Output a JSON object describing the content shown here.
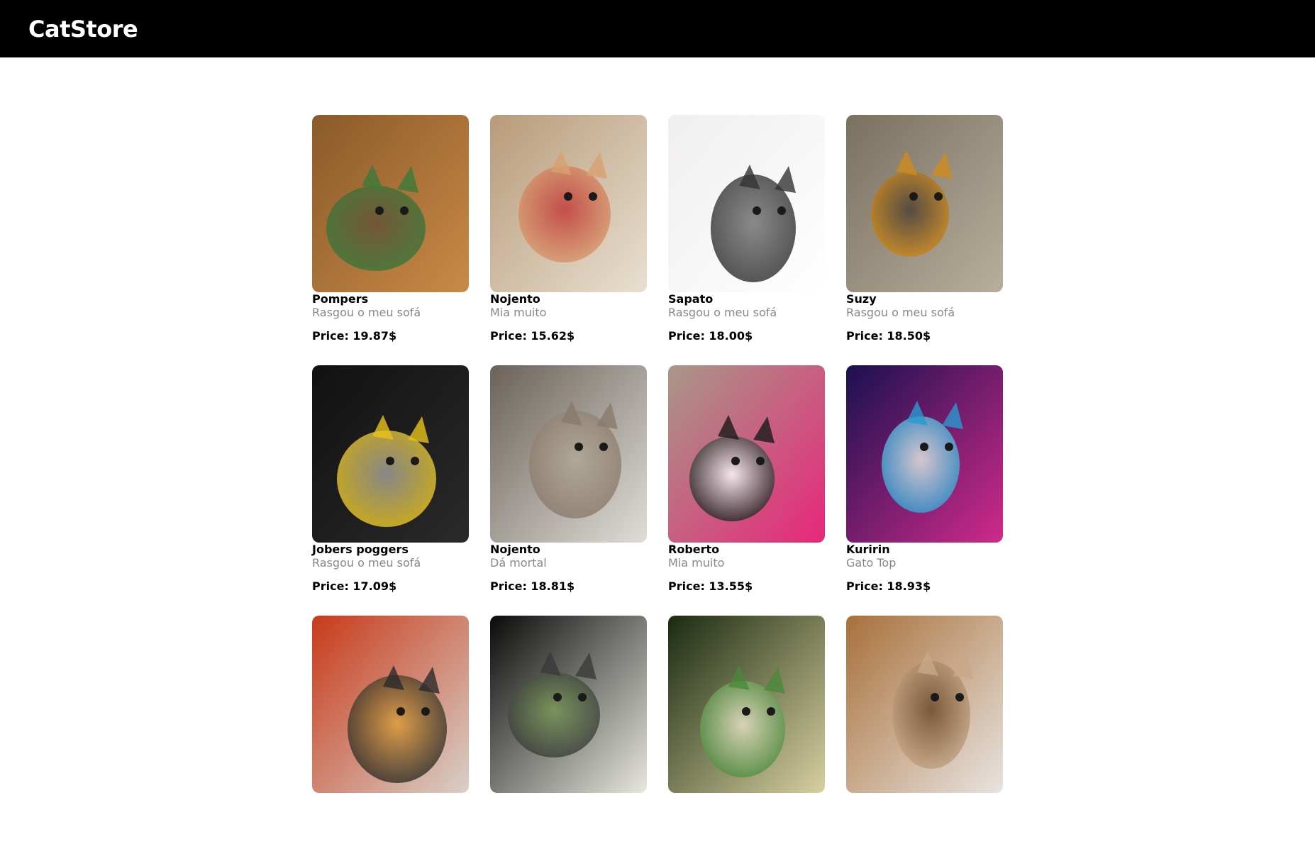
{
  "header": {
    "brand": "CatStore"
  },
  "products": [
    {
      "name": "Pompers",
      "description": "Rasgou o meu sofá",
      "price": "Price: 19.87$",
      "image": "cat-photo",
      "palette": [
        "#8a5a2a",
        "#c98a45",
        "#3a7a3a",
        "#6b5138"
      ]
    },
    {
      "name": "Nojento",
      "description": "Mia muito",
      "price": "Price: 15.62$",
      "image": "cat-photo",
      "palette": [
        "#b89a7a",
        "#e8e0d0",
        "#d8a070",
        "#c23a3a"
      ]
    },
    {
      "name": "Sapato",
      "description": "Rasgou o meu sofá",
      "price": "Price: 18.00$",
      "image": "cat-photo",
      "palette": [
        "#f0eeee",
        "#ffffff",
        "#333333",
        "#777777"
      ]
    },
    {
      "name": "Suzy",
      "description": "Rasgou o meu sofá",
      "price": "Price: 18.50$",
      "image": "cat-photo",
      "palette": [
        "#7a7060",
        "#b8ae9c",
        "#d08a1a",
        "#4a4038"
      ]
    },
    {
      "name": "Jobers poggers",
      "description": "Rasgou o meu sofá",
      "price": "Price: 17.09$",
      "image": "cat-photo",
      "palette": [
        "#111111",
        "#2a2a2a",
        "#e8c21a",
        "#999999"
      ]
    },
    {
      "name": "Nojento",
      "description": "Dá mortal",
      "price": "Price: 18.81$",
      "image": "cat-photo",
      "palette": [
        "#6a625a",
        "#e0ddd8",
        "#8a7a6a",
        "#b0a898"
      ]
    },
    {
      "name": "Roberto",
      "description": "Mia muito",
      "price": "Price: 13.55$",
      "image": "cat-photo",
      "palette": [
        "#a89888",
        "#e8267a",
        "#1a1a1a",
        "#ffffff"
      ]
    },
    {
      "name": "Kuririn",
      "description": "Gato Top",
      "price": "Price: 18.93$",
      "image": "cat-photo",
      "palette": [
        "#1a1050",
        "#d02a8a",
        "#2a9ad0",
        "#e8e4e0"
      ]
    },
    {
      "name": "",
      "description": "",
      "price": "",
      "image": "cat-photo",
      "palette": [
        "#c83a1a",
        "#d8d0c8",
        "#2a2a2a",
        "#e0a040"
      ]
    },
    {
      "name": "",
      "description": "",
      "price": "",
      "image": "cat-photo",
      "palette": [
        "#0a0a0a",
        "#e8e8e0",
        "#3a3a3a",
        "#7a9a5a"
      ]
    },
    {
      "name": "",
      "description": "",
      "price": "",
      "image": "cat-photo",
      "palette": [
        "#1a2a10",
        "#d8d0a0",
        "#4a8a3a",
        "#e8e0c8"
      ]
    },
    {
      "name": "",
      "description": "",
      "price": "",
      "image": "cat-photo",
      "palette": [
        "#a8703a",
        "#e8e4e0",
        "#c8a888",
        "#6a4a2a"
      ]
    }
  ]
}
